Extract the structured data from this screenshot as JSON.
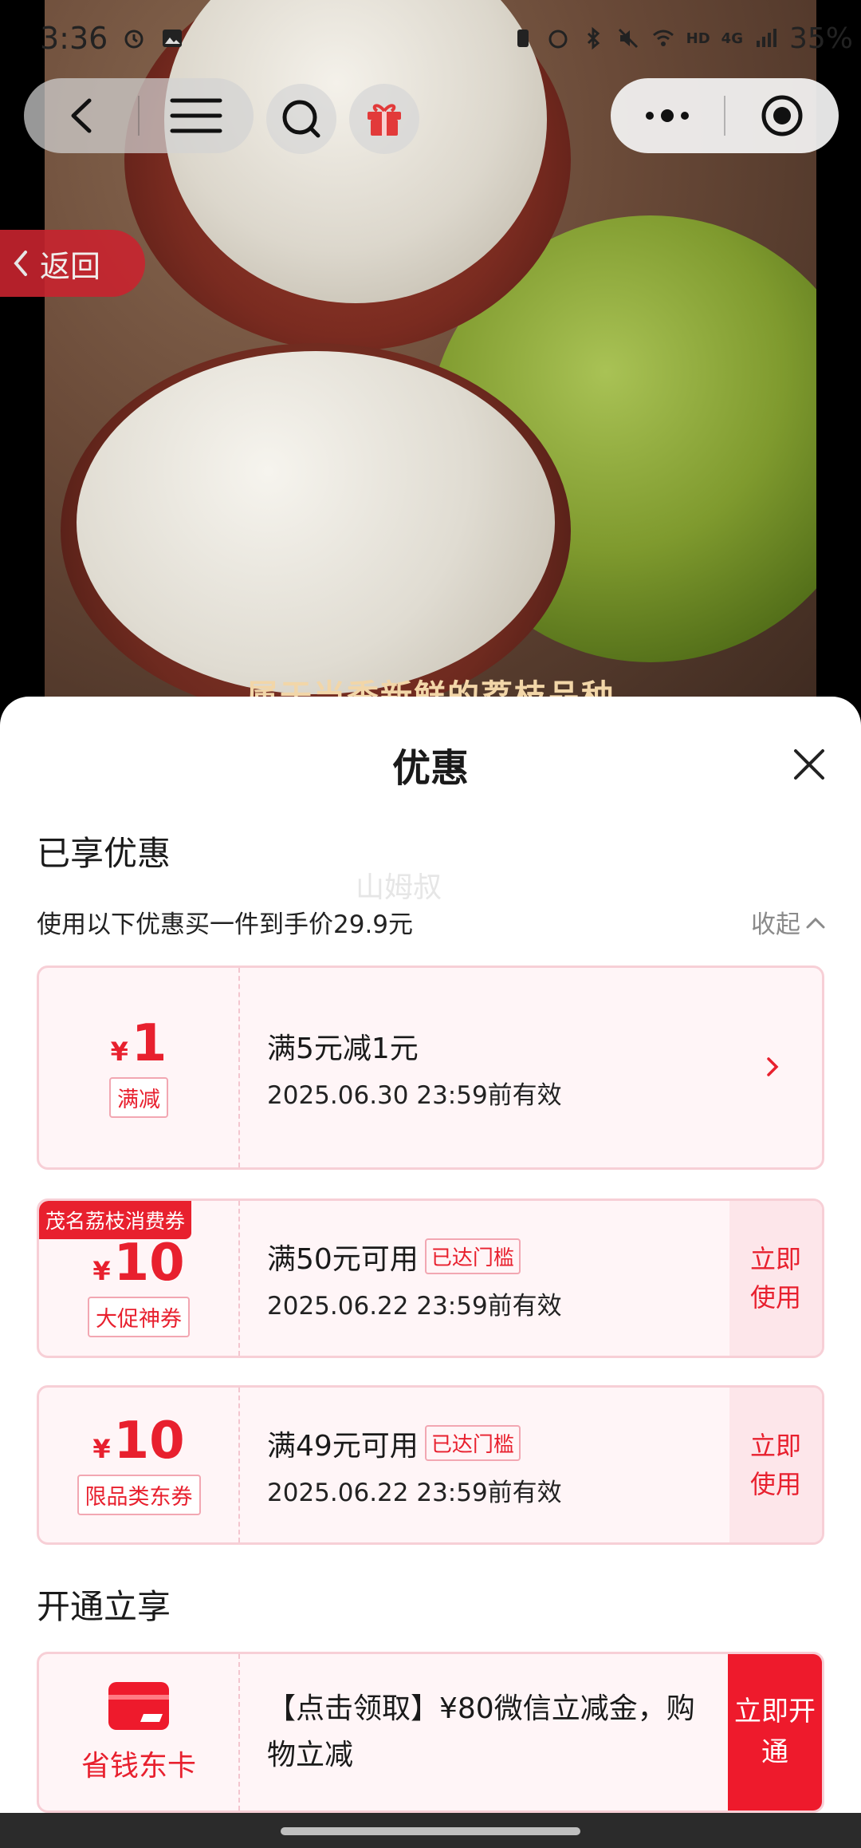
{
  "status_bar": {
    "time": "3:36",
    "network_small": "HD",
    "signal_small": "4G",
    "battery": "35%"
  },
  "nav": {
    "back_tag_label": "返回"
  },
  "photo": {
    "caption": "属于当季新鲜的荔枝品种"
  },
  "sheet": {
    "title": "优惠",
    "enjoyed_title": "已享优惠",
    "watermark": "山姆叔",
    "summary": "使用以下优惠买一件到手价29.9元",
    "collapse_label": "收起",
    "coupons": [
      {
        "yen": "¥",
        "amount": "1",
        "tag": "满减",
        "condition": "满5元减1元",
        "validity": "2025.06.30 23:59前有效"
      },
      {
        "ribbon": "茂名荔枝消费券",
        "yen": "¥",
        "amount": "10",
        "tag": "大促神券",
        "condition": "满50元可用",
        "reached": "已达门槛",
        "validity": "2025.06.22 23:59前有效",
        "action_line1": "立即",
        "action_line2": "使用"
      },
      {
        "yen": "¥",
        "amount": "10",
        "tag": "限品类东券",
        "condition": "满49元可用",
        "reached": "已达门槛",
        "validity": "2025.06.22 23:59前有效",
        "action_line1": "立即",
        "action_line2": "使用"
      }
    ],
    "open_title": "开通立享",
    "card": {
      "name": "省钱东卡",
      "desc": "【点击领取】¥80微信立减金，购物立减",
      "action_line1": "立即开",
      "action_line2": "通"
    }
  },
  "colors": {
    "accent": "#e8202e",
    "coupon_bg": "#fff5f7",
    "coupon_border": "#f7cfd6"
  }
}
